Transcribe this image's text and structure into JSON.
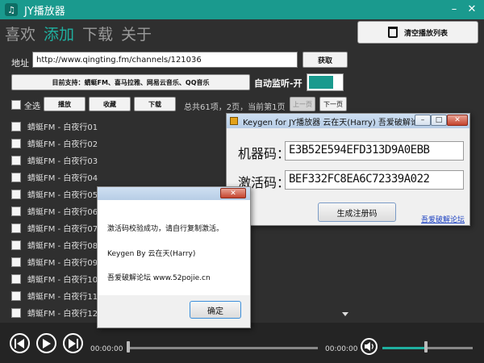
{
  "app": {
    "title": "JY播放器",
    "minimize_glyph": "–",
    "close_glyph": "✕"
  },
  "tabs": [
    {
      "label": "喜欢",
      "active": false
    },
    {
      "label": "添加",
      "active": true
    },
    {
      "label": "下载",
      "active": false
    },
    {
      "label": "关于",
      "active": false
    }
  ],
  "clear_button": {
    "label": "清空播放列表",
    "icon": "trash-icon"
  },
  "address": {
    "label": "地址",
    "value": "http://www.qingting.fm/channels/121036",
    "fetch_label": "获取"
  },
  "support_text": "目前支持：蜻蜓FM、喜马拉雅、网易云音乐、QQ音乐",
  "monitor": {
    "label": "自动监听-开",
    "on": true
  },
  "toolbar": {
    "select_all": "全选",
    "play": "播放",
    "collect": "收藏",
    "download": "下载",
    "page_info": "总共61项，2页，当前第1页",
    "prev": "上一页",
    "next": "下一页"
  },
  "tracks": [
    "蜻蜓FM - 白夜行01",
    "蜻蜓FM - 白夜行02",
    "蜻蜓FM - 白夜行03",
    "蜻蜓FM - 白夜行04",
    "蜻蜓FM - 白夜行05",
    "蜻蜓FM - 白夜行06",
    "蜻蜓FM - 白夜行07",
    "蜻蜓FM - 白夜行08",
    "蜻蜓FM - 白夜行09",
    "蜻蜓FM - 白夜行10",
    "蜻蜓FM - 白夜行11",
    "蜻蜓FM - 白夜行12"
  ],
  "player": {
    "current_time": "00:00:00",
    "total_time": "00:00:00",
    "progress": 0,
    "volume": 0.48,
    "buttons": [
      "previous-icon",
      "play-icon",
      "next-icon",
      "volume-icon"
    ]
  },
  "keygen": {
    "title": "Keygen for JY播放器  云在天(Harry) 吾爱破解论坛",
    "machine_label": "机器码：",
    "machine_code": "E3B52E594EFD313D9A0EBB",
    "activation_label": "激活码：",
    "activation_code": "BEF332FC8EA6C72339A022",
    "generate_label": "生成注册码",
    "forum_link": "吾爱破解论坛"
  },
  "message_box": {
    "line1": "激活码校验成功，请自行复制激活。",
    "line2": "Keygen By  云在天(Harry)",
    "line3": "吾爱破解论坛 www.52pojie.cn",
    "ok_label": "确定",
    "close_glyph": "✕"
  },
  "colors": {
    "accent": "#1a9a8e",
    "active_tab": "#1fb0a0",
    "background": "#2f2f2f"
  }
}
